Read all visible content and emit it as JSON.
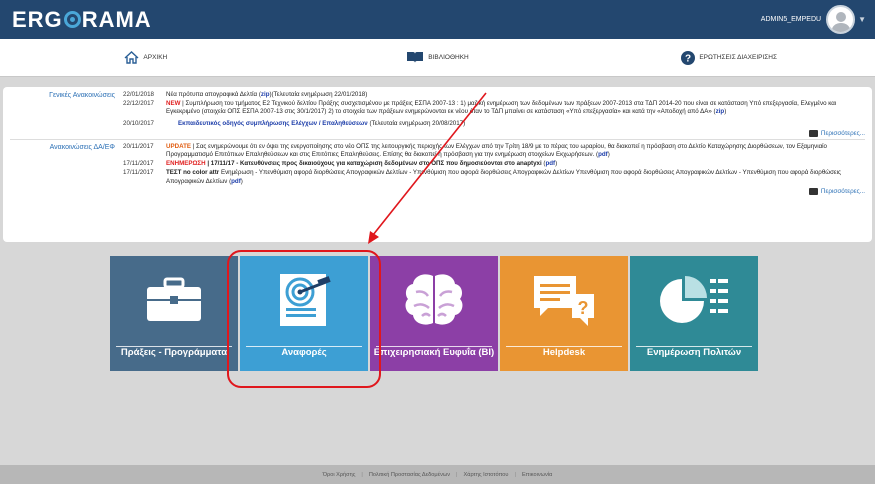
{
  "header": {
    "logo_left": "ERG",
    "logo_right": "RAMA",
    "user": "ADMIN5_EMPEDU"
  },
  "nav": [
    {
      "label": "ΑΡΧΙΚΗ",
      "icon": "home-icon"
    },
    {
      "label": "ΒΙΒΛΙΟΘΗΚΗ",
      "icon": "book-icon"
    },
    {
      "label": "ΕΡΩΤΗΣΕΙΣ ΔΙΑΧΕΙΡΙΣΗΣ",
      "icon": "question-icon"
    }
  ],
  "general": {
    "title": "Γενικές Ανακοινώσεις",
    "items": [
      {
        "date": "22/01/2018",
        "text": "Νέα πρότυπα απογραφικά Δελτία (",
        "link": "zip",
        "text2": ")(Τελευταία ενημέρωση 22/01/2018)"
      },
      {
        "date": "22/12/2017",
        "badge": "NEW",
        "text": " | Συμπλήρωση του τμήματος Ε2 Τεχνικού δελτίου Πράξης συσχετισμένου με πράξεις ΕΣΠΑ 2007-13 : 1) μαζική ενημέρωση των δεδομένων των πράξεων 2007-2013 στα ΤΔΠ 2014-20 που είναι σε κατάσταση Υπό επεξεργασία, Ελεγμένο και Εγκεκριμένο (στοιχεία ΟΠΣ ΕΣΠΑ 2007-13 στις 30/1/2017) 2) το στοιχεία των πράξεων ενημερώνονται εκ νέου όταν το ΤΔΠ μπαίνει σε κατάσταση «Υπό επεξεργασία» και κατά την «Αποδοχή από ΔΑ» (",
        "link": "zip",
        "text2": ")"
      },
      {
        "date": "20/10/2017",
        "link": "Εκπαιδευτικός οδηγός συμπλήρωσης Ελέγχων / Επαληθεύσεων",
        "text2": " (Τελευταία ενημέρωση 20/08/2017)"
      }
    ],
    "more": "Περισσότερες..."
  },
  "da": {
    "title": "Ανακοινώσεις ΔΑ/ΕΦ",
    "items": [
      {
        "date": "20/11/2017",
        "badge": "UPDATE",
        "text": " | Σας ενημερώνουμε ότι εν όψει της ενεργοποίησης στο νέο ΟΠΣ της λειτουργικής περιοχής των Ελέγχων από την Τρίτη 18/9 με το πέρας του ωραρίου, θα διακοπεί η πρόσβαση στο Δελτίο Καταχώρησης Διορθώσεων, τον Εξαμηνιαίο Προγραμματισμό Επιτόπιων Επαληθεύσεων και στις Επιτόπιες Επαληθεύσεις. Επίσης θα διακοπεί η πρόσβαση για την ενημέρωση στοιχείων Εκχωρήσεων. (",
        "link": "pdf",
        "text2": ")"
      },
      {
        "date": "17/11/2017",
        "badge": "ΕΝΗΜΕΡΩΣΗ",
        "bold": " | 17/11/17 - Κατευθύνσεις προς δικαιούχους για καταχώριση δεδομένων στο ΟΠΣ που δημοσιεύονται στο anaptyxi",
        "text": " (",
        "link": "pdf",
        "text2": ")"
      },
      {
        "date": "17/11/2017",
        "bold": "ΤΕΣΤ no color attr",
        "text": " Ενημέρωση - Υπενθύμιση αφορά διορθώσεις Απογραφικών Δελτίων - Υπενθύμιση που αφορά διορθώσεις Απογραφικών Δελτίων Υπενθύμιση που αφορά διορθώσεις Απογραφικών Δελτίων - Υπενθύμιση που αφορά διορθώσεις Απογραφικών Δελτίων (",
        "link": "pdf",
        "text2": ")"
      }
    ],
    "more": "Περισσότερες..."
  },
  "tiles": [
    {
      "label": "Πράξεις - Προγράμματα",
      "icon": "briefcase-icon",
      "color": "#476b8a"
    },
    {
      "label": "Αναφορές",
      "icon": "target-report-icon",
      "color": "#3d9fd4"
    },
    {
      "label": "Επιχειρησιακή Ευφυΐα (BI)",
      "icon": "brain-icon",
      "color": "#8c3fa6"
    },
    {
      "label": "Helpdesk",
      "icon": "chat-help-icon",
      "color": "#e99533"
    },
    {
      "label": "Ενημέρωση Πολιτών",
      "icon": "pie-chart-icon",
      "color": "#2f8a96"
    }
  ],
  "footer": [
    "Όροι Χρήσης",
    "Πολιτική Προστασίας Δεδομένων",
    "Χάρτης Ιστοτόπου",
    "Επικοινωνία"
  ]
}
